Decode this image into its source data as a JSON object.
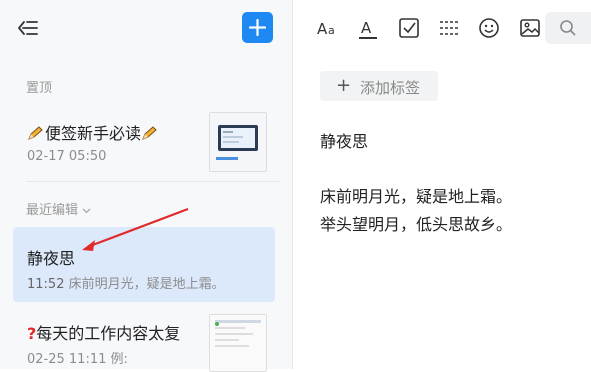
{
  "sidebar": {
    "pinned_label": "置顶",
    "recent_label": "最近编辑",
    "pinned_note": {
      "title": "便签新手必读",
      "date": "02-17 05:50"
    },
    "selected_note": {
      "title": "静夜思",
      "time": "11:52",
      "preview": "床前明月光，疑是地上霜。"
    },
    "third_note": {
      "title": "每天的工作内容太复",
      "date": "02-25 11:11",
      "preview": "例:"
    }
  },
  "toolbar": {
    "icons": [
      "font-size-icon",
      "font-color-icon",
      "checkbox-icon",
      "divider-icon",
      "emoji-icon",
      "image-icon",
      "search-icon"
    ]
  },
  "editor": {
    "add_tag_label": "添加标签",
    "title": "静夜思",
    "lines": [
      "床前明月光，疑是地上霜。",
      "举头望明月，低头思故乡。"
    ]
  },
  "colors": {
    "accent": "#1e88f3",
    "selected_bg": "#dce9fb",
    "arrow": "#e02b2b"
  }
}
